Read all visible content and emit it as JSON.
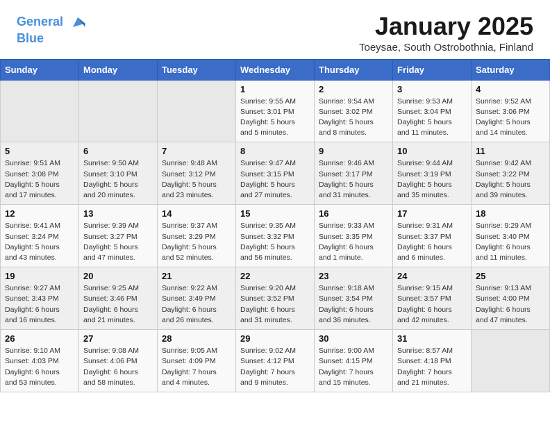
{
  "header": {
    "logo_line1": "General",
    "logo_line2": "Blue",
    "title": "January 2025",
    "subtitle": "Toeysae, South Ostrobothnia, Finland"
  },
  "calendar": {
    "days_of_week": [
      "Sunday",
      "Monday",
      "Tuesday",
      "Wednesday",
      "Thursday",
      "Friday",
      "Saturday"
    ],
    "weeks": [
      [
        {
          "day": "",
          "info": ""
        },
        {
          "day": "",
          "info": ""
        },
        {
          "day": "",
          "info": ""
        },
        {
          "day": "1",
          "info": "Sunrise: 9:55 AM\nSunset: 3:01 PM\nDaylight: 5 hours\nand 5 minutes."
        },
        {
          "day": "2",
          "info": "Sunrise: 9:54 AM\nSunset: 3:02 PM\nDaylight: 5 hours\nand 8 minutes."
        },
        {
          "day": "3",
          "info": "Sunrise: 9:53 AM\nSunset: 3:04 PM\nDaylight: 5 hours\nand 11 minutes."
        },
        {
          "day": "4",
          "info": "Sunrise: 9:52 AM\nSunset: 3:06 PM\nDaylight: 5 hours\nand 14 minutes."
        }
      ],
      [
        {
          "day": "5",
          "info": "Sunrise: 9:51 AM\nSunset: 3:08 PM\nDaylight: 5 hours\nand 17 minutes."
        },
        {
          "day": "6",
          "info": "Sunrise: 9:50 AM\nSunset: 3:10 PM\nDaylight: 5 hours\nand 20 minutes."
        },
        {
          "day": "7",
          "info": "Sunrise: 9:48 AM\nSunset: 3:12 PM\nDaylight: 5 hours\nand 23 minutes."
        },
        {
          "day": "8",
          "info": "Sunrise: 9:47 AM\nSunset: 3:15 PM\nDaylight: 5 hours\nand 27 minutes."
        },
        {
          "day": "9",
          "info": "Sunrise: 9:46 AM\nSunset: 3:17 PM\nDaylight: 5 hours\nand 31 minutes."
        },
        {
          "day": "10",
          "info": "Sunrise: 9:44 AM\nSunset: 3:19 PM\nDaylight: 5 hours\nand 35 minutes."
        },
        {
          "day": "11",
          "info": "Sunrise: 9:42 AM\nSunset: 3:22 PM\nDaylight: 5 hours\nand 39 minutes."
        }
      ],
      [
        {
          "day": "12",
          "info": "Sunrise: 9:41 AM\nSunset: 3:24 PM\nDaylight: 5 hours\nand 43 minutes."
        },
        {
          "day": "13",
          "info": "Sunrise: 9:39 AM\nSunset: 3:27 PM\nDaylight: 5 hours\nand 47 minutes."
        },
        {
          "day": "14",
          "info": "Sunrise: 9:37 AM\nSunset: 3:29 PM\nDaylight: 5 hours\nand 52 minutes."
        },
        {
          "day": "15",
          "info": "Sunrise: 9:35 AM\nSunset: 3:32 PM\nDaylight: 5 hours\nand 56 minutes."
        },
        {
          "day": "16",
          "info": "Sunrise: 9:33 AM\nSunset: 3:35 PM\nDaylight: 6 hours\nand 1 minute."
        },
        {
          "day": "17",
          "info": "Sunrise: 9:31 AM\nSunset: 3:37 PM\nDaylight: 6 hours\nand 6 minutes."
        },
        {
          "day": "18",
          "info": "Sunrise: 9:29 AM\nSunset: 3:40 PM\nDaylight: 6 hours\nand 11 minutes."
        }
      ],
      [
        {
          "day": "19",
          "info": "Sunrise: 9:27 AM\nSunset: 3:43 PM\nDaylight: 6 hours\nand 16 minutes."
        },
        {
          "day": "20",
          "info": "Sunrise: 9:25 AM\nSunset: 3:46 PM\nDaylight: 6 hours\nand 21 minutes."
        },
        {
          "day": "21",
          "info": "Sunrise: 9:22 AM\nSunset: 3:49 PM\nDaylight: 6 hours\nand 26 minutes."
        },
        {
          "day": "22",
          "info": "Sunrise: 9:20 AM\nSunset: 3:52 PM\nDaylight: 6 hours\nand 31 minutes."
        },
        {
          "day": "23",
          "info": "Sunrise: 9:18 AM\nSunset: 3:54 PM\nDaylight: 6 hours\nand 36 minutes."
        },
        {
          "day": "24",
          "info": "Sunrise: 9:15 AM\nSunset: 3:57 PM\nDaylight: 6 hours\nand 42 minutes."
        },
        {
          "day": "25",
          "info": "Sunrise: 9:13 AM\nSunset: 4:00 PM\nDaylight: 6 hours\nand 47 minutes."
        }
      ],
      [
        {
          "day": "26",
          "info": "Sunrise: 9:10 AM\nSunset: 4:03 PM\nDaylight: 6 hours\nand 53 minutes."
        },
        {
          "day": "27",
          "info": "Sunrise: 9:08 AM\nSunset: 4:06 PM\nDaylight: 6 hours\nand 58 minutes."
        },
        {
          "day": "28",
          "info": "Sunrise: 9:05 AM\nSunset: 4:09 PM\nDaylight: 7 hours\nand 4 minutes."
        },
        {
          "day": "29",
          "info": "Sunrise: 9:02 AM\nSunset: 4:12 PM\nDaylight: 7 hours\nand 9 minutes."
        },
        {
          "day": "30",
          "info": "Sunrise: 9:00 AM\nSunset: 4:15 PM\nDaylight: 7 hours\nand 15 minutes."
        },
        {
          "day": "31",
          "info": "Sunrise: 8:57 AM\nSunset: 4:18 PM\nDaylight: 7 hours\nand 21 minutes."
        },
        {
          "day": "",
          "info": ""
        }
      ]
    ]
  }
}
